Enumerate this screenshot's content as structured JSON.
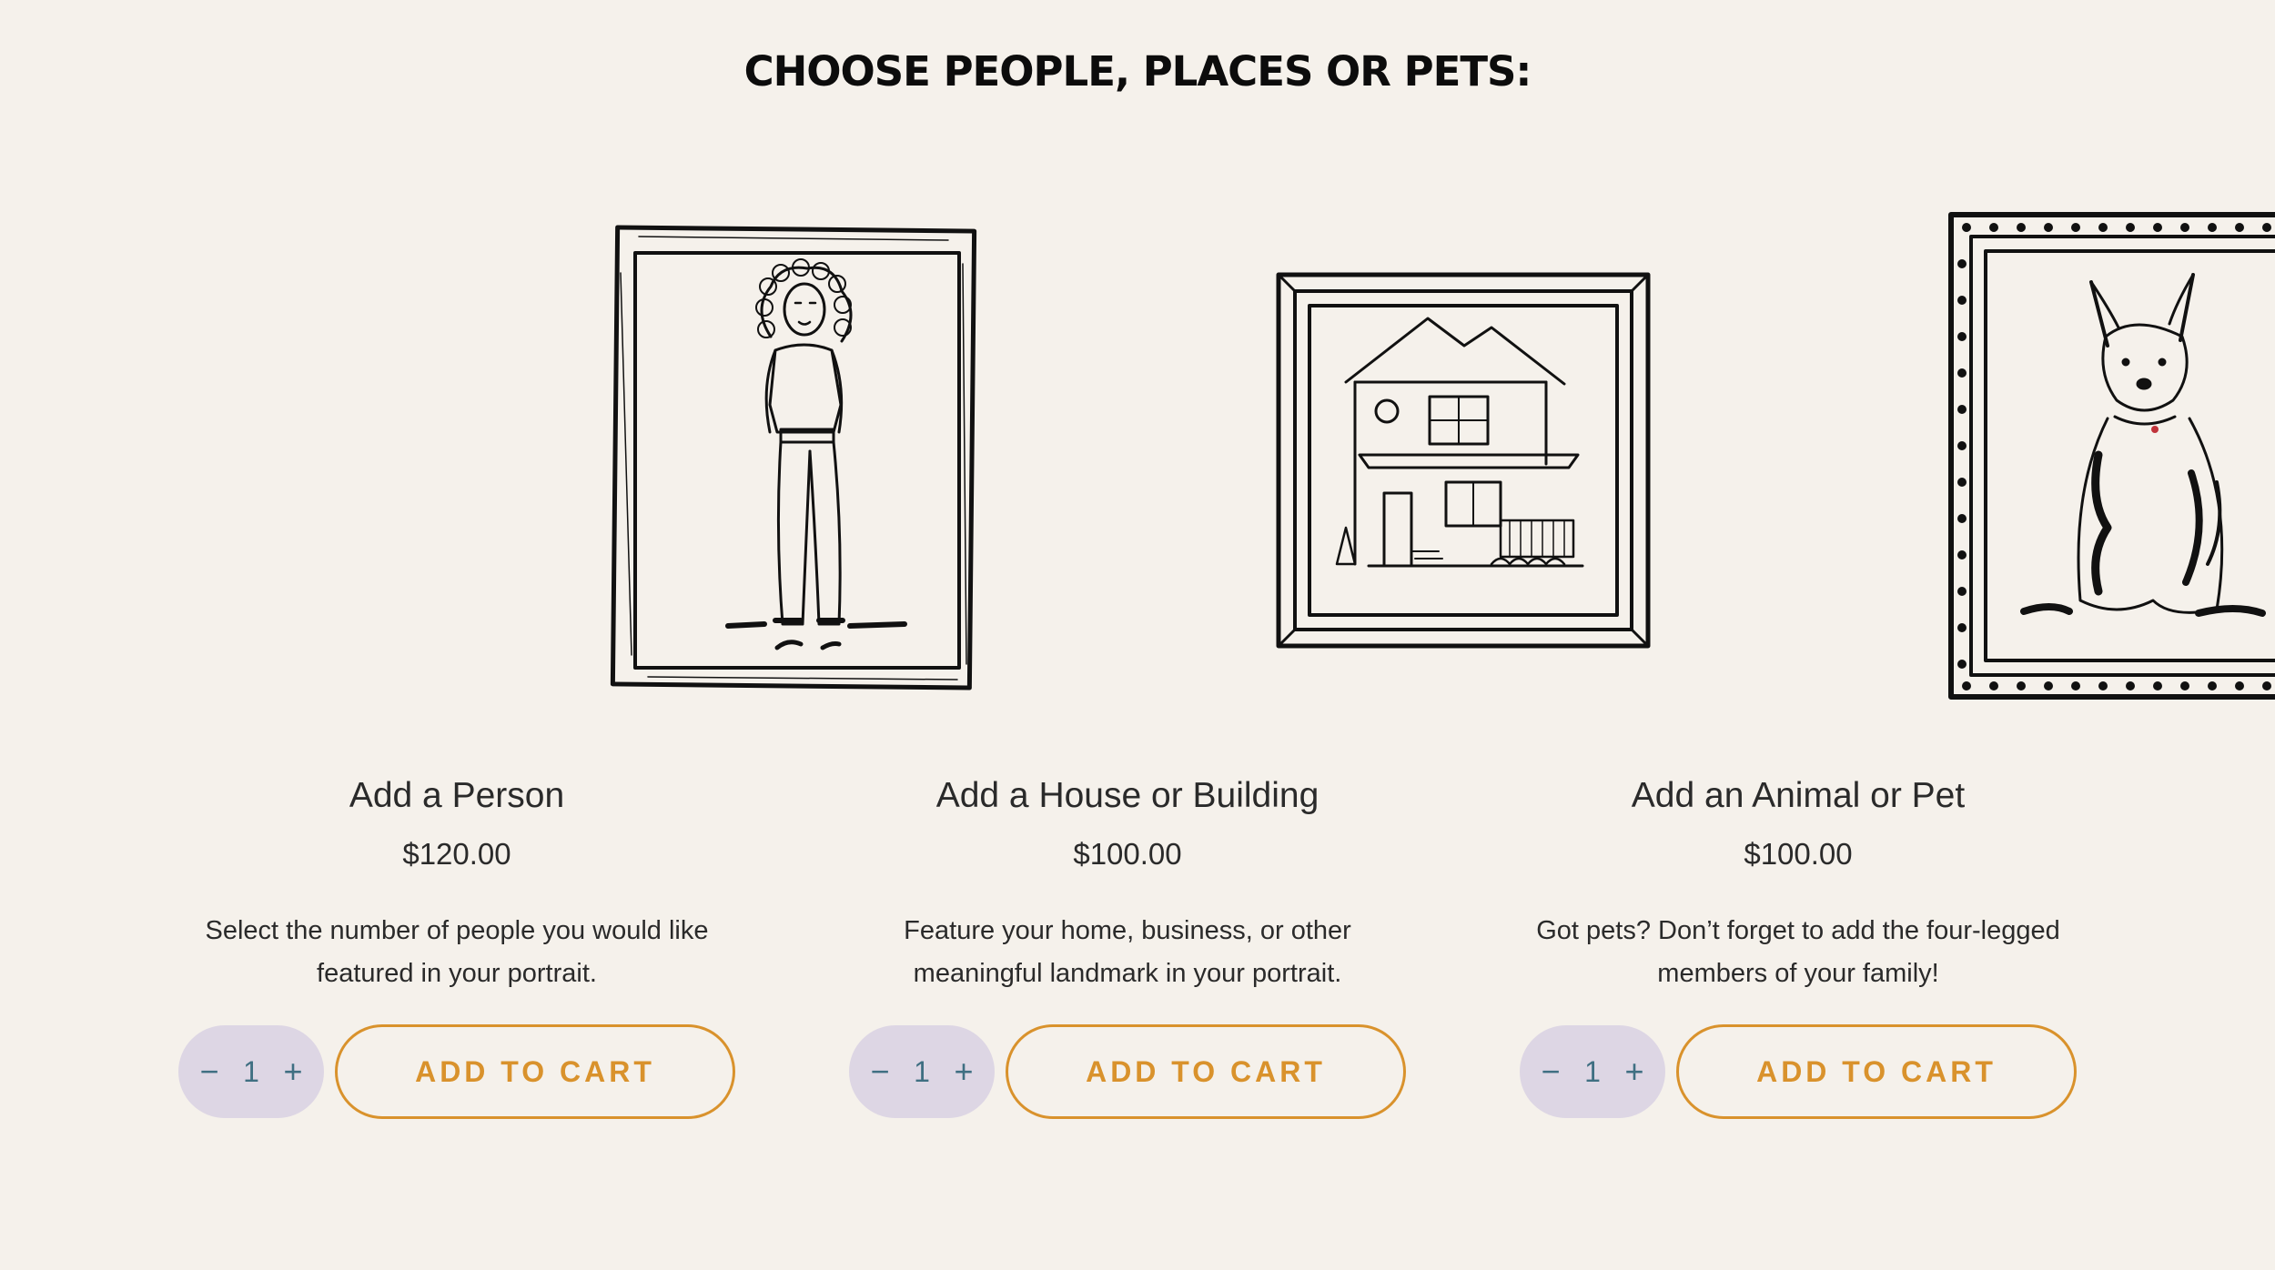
{
  "page_title": "CHOOSE PEOPLE, PLACES OR PETS:",
  "accent_color": "#d9922c",
  "stepper_color": "#ddd6e4",
  "products": [
    {
      "name": "Add a Person",
      "price": "$120.00",
      "description": "Select the number of people you would like featured in your portrait.",
      "quantity": "1",
      "decrement": "−",
      "increment": "+",
      "cta": "ADD TO CART",
      "illustration": "person-portrait-icon"
    },
    {
      "name": "Add a House or Building",
      "price": "$100.00",
      "description": "Feature your home, business, or other meaningful landmark in your portrait.",
      "quantity": "1",
      "decrement": "−",
      "increment": "+",
      "cta": "ADD TO CART",
      "illustration": "house-portrait-icon"
    },
    {
      "name": "Add an Animal or Pet",
      "price": "$100.00",
      "description": "Got pets? Don’t forget to add the four-legged members of your family!",
      "quantity": "1",
      "decrement": "−",
      "increment": "+",
      "cta": "ADD TO CART",
      "illustration": "dog-portrait-icon"
    }
  ]
}
